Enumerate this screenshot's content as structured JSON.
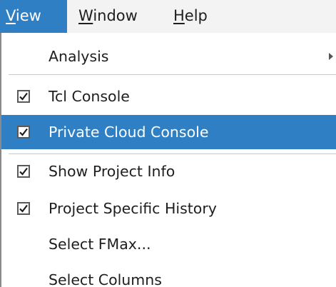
{
  "menubar": {
    "items": [
      {
        "mnemonic": "V",
        "rest": "iew",
        "active": true
      },
      {
        "mnemonic": "W",
        "rest": "indow",
        "active": false
      },
      {
        "mnemonic": "H",
        "rest": "elp",
        "active": false
      }
    ]
  },
  "view_menu": {
    "items": [
      {
        "label": "Analysis",
        "checked": null,
        "submenu": true
      },
      {
        "label": "Tcl Console",
        "checked": true
      },
      {
        "label": "Private Cloud Console",
        "checked": true,
        "highlighted": true
      },
      {
        "label": "Show Project Info",
        "checked": true
      },
      {
        "label": "Project Specific History",
        "checked": true
      },
      {
        "label": "Select FMax...",
        "checked": null
      },
      {
        "label": "Select Columns",
        "checked": null
      }
    ]
  },
  "colors": {
    "highlight": "#2f7fc4",
    "menubar_bg": "#f3f3f3"
  }
}
